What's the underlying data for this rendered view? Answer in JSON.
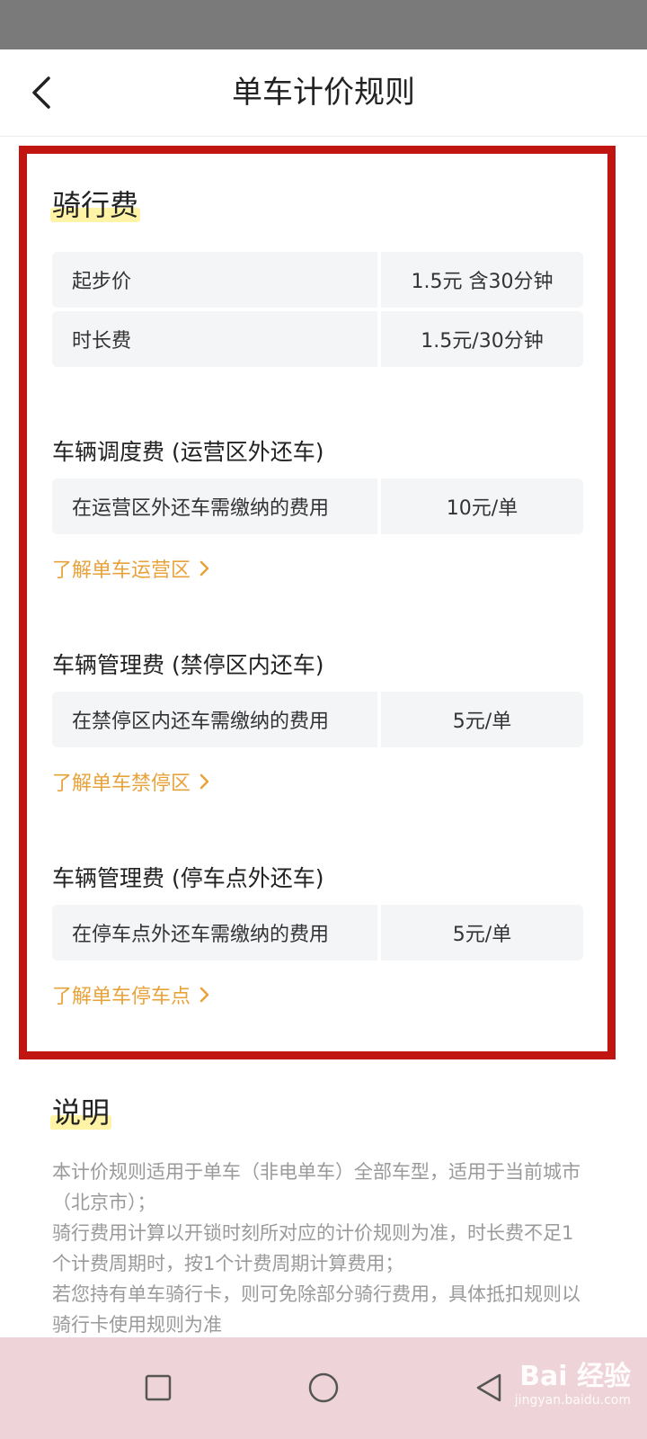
{
  "header": {
    "title": "单车计价规则",
    "back_icon": "chevron-left-icon"
  },
  "riding": {
    "title": "骑行费",
    "rows": [
      {
        "label": "起步价",
        "value": "1.5元 含30分钟"
      },
      {
        "label": "时长费",
        "value": "1.5元/30分钟"
      }
    ]
  },
  "dispatch": {
    "title": "车辆调度费 (运营区外还车)",
    "row": {
      "label": "在运营区外还车需缴纳的费用",
      "value": "10元/单"
    },
    "link": "了解单车运营区"
  },
  "mgmt_noparking": {
    "title": "车辆管理费 (禁停区内还车)",
    "row": {
      "label": "在禁停区内还车需缴纳的费用",
      "value": "5元/单"
    },
    "link": "了解单车禁停区"
  },
  "mgmt_parkingspot": {
    "title": "车辆管理费 (停车点外还车)",
    "row": {
      "label": "在停车点外还车需缴纳的费用",
      "value": "5元/单"
    },
    "link": "了解单车停车点"
  },
  "description": {
    "title": "说明",
    "paragraphs": [
      "本计价规则适用于单车（非电单车）全部车型，适用于当前城市（北京市）；",
      "骑行费用计算以开锁时刻所对应的计价规则为准，时长费不足1个计费周期时，按1个计费周期计算费用；",
      "若您持有单车骑行卡，则可免除部分骑行费用，具体抵扣规则以骑行卡使用规则为准"
    ]
  },
  "navbar": {
    "icons": [
      "square-icon",
      "circle-icon",
      "triangle-back-icon"
    ]
  },
  "watermark": {
    "main": "Bai 经验",
    "sub": "jingyan.baidu.com"
  },
  "colors": {
    "accent_link": "#e8a23a",
    "highlight_box": "#c11512",
    "highlight_text_bg": "#fff3a6"
  }
}
